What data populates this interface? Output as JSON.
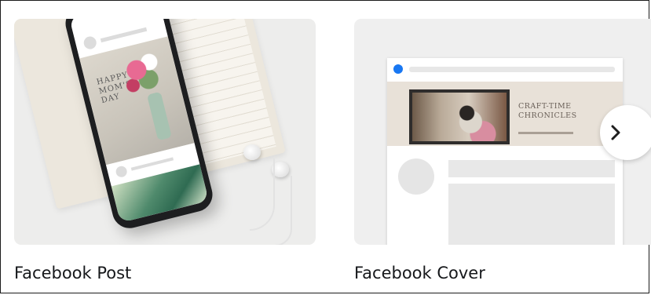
{
  "cards": [
    {
      "label": "Facebook Post",
      "thumbnail": {
        "post_text": "HAPPY MOM'S DAY",
        "accent_colors": [
          "#e86a93",
          "#4f8a6c",
          "#1d1e20"
        ]
      }
    },
    {
      "label": "Facebook Cover",
      "thumbnail": {
        "cover_title_line1": "CRAFT-TIME",
        "cover_title_line2": "CHRONICLES",
        "brand_color": "#1877f2"
      }
    }
  ],
  "carousel": {
    "next_icon": "chevron-right-icon"
  }
}
